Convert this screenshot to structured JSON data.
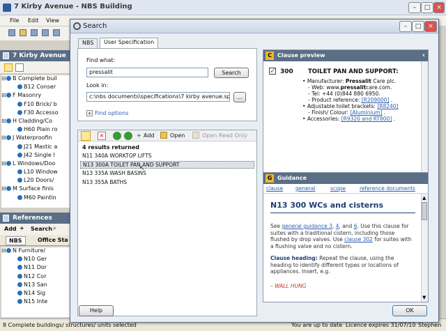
{
  "app": {
    "title": "7 Kirby Avenue - NBS Building",
    "menus": [
      "File",
      "Edit",
      "View"
    ]
  },
  "left_panel": {
    "header": "7 Kirby Avenue",
    "tree": [
      {
        "label": "B Complete buil",
        "level": 0,
        "expanded": true
      },
      {
        "label": "B12 Conser",
        "level": 1
      },
      {
        "label": "F Masonry",
        "level": 0,
        "expanded": true
      },
      {
        "label": "F10 Brick/ b",
        "level": 1
      },
      {
        "label": "F30 Accesso",
        "level": 1
      },
      {
        "label": "H Cladding/Co",
        "level": 0,
        "expanded": true
      },
      {
        "label": "H60 Plain ro",
        "level": 1
      },
      {
        "label": "J Waterproofin",
        "level": 0,
        "expanded": true
      },
      {
        "label": "J21 Mastic a",
        "level": 1
      },
      {
        "label": "J42 Single l",
        "level": 1
      },
      {
        "label": "L Windows/Doo",
        "level": 0,
        "expanded": true
      },
      {
        "label": "L10 Window",
        "level": 1
      },
      {
        "label": "L20 Doors/",
        "level": 1
      },
      {
        "label": "M Surface finis",
        "level": 0,
        "expanded": true
      },
      {
        "label": "M60 Paintin",
        "level": 1
      }
    ]
  },
  "references_panel": {
    "header": "References",
    "add_label": "Add",
    "search_label": "Search",
    "tabs": [
      "NBS",
      "Office Sta"
    ],
    "tree": [
      {
        "label": "N Furniture/",
        "level": 0
      },
      {
        "label": "N10 Ger",
        "level": 1
      },
      {
        "label": "N11 Dor",
        "level": 1
      },
      {
        "label": "N12 Cor",
        "level": 1
      },
      {
        "label": "N13 San",
        "level": 1
      },
      {
        "label": "N14 Sig",
        "level": 1
      },
      {
        "label": "N15 Inte",
        "level": 1
      }
    ]
  },
  "statusbar": {
    "left": "8 Complete buildings/ structures/ units selected",
    "mid": "You are up to date",
    "licence": "Licence expires 31/07/10",
    "user": "Stephen"
  },
  "dialog": {
    "title": "Search",
    "tabs": [
      "NBS",
      "User Specification"
    ],
    "find_what_label": "Find what:",
    "find_what_value": "pressalit",
    "search_button": "Search",
    "look_in_label": "Look in:",
    "look_in_value": "c:\\nbs documents\\specifications\\7 kirby avenue.spec",
    "browse_button": "...",
    "find_options": "Find options",
    "results_toolbar": {
      "add": "Add",
      "open": "Open",
      "open_read_only": "Open Read Only"
    },
    "results_count": "4 results returned",
    "results": [
      "N11 340A WORKTOP LIFTS",
      "N13 300A TOILET PAN AND SUPPORT",
      "N13 335A WASH BASINS",
      "N13 355A BATHS"
    ],
    "help_button": "Help",
    "ok_button": "OK"
  },
  "clause_preview": {
    "header_letter": "C",
    "header": "Clause preview",
    "number": "300",
    "title": "TOILET PAN AND SUPPORT:",
    "manufacturer_label": "Manufacturer:",
    "manufacturer": "Pressalit",
    "manufacturer_rest": "Care plc.",
    "web_label": "- Web: www.",
    "web_bold": "pressalit",
    "web_rest": "care.com.",
    "tel": "- Tel: +44 (0)844 880 6950.",
    "product_ref_label": "- Product reference:",
    "product_ref": "[R209000]",
    "brackets_label": "Adjustable toilet brackets:",
    "brackets_ref": "[R8240]",
    "finish_label": "- Finish/ Colour:",
    "finish_ref": "[Aluminium]",
    "accessories_label": "Accessories:",
    "accessories_ref1": "[R9320 and RT800]"
  },
  "guidance": {
    "header_letter": "G",
    "header": "Guidance",
    "links": [
      "clause",
      "general",
      "scope",
      "reference documents"
    ],
    "heading": "N13 300 WCs and cisterns",
    "p1_pre": "See ",
    "p1_link1": "general guidance 3",
    "p1_sep1": ", ",
    "p1_link2": "4",
    "p1_sep2": ", and ",
    "p1_link3": "6",
    "p1_mid": ". Use this clause for suites with a traditional cistern, including those flushed by drop valves. Use ",
    "p1_link4": "clause 302",
    "p1_post": " for suites with a flushing valve and no cistern.",
    "p2_bold": "Clause heading:",
    "p2_text": " Repeat the clause, using the heading to identify different types or locations of appliances. Insert, e.g.",
    "p3": "– WALL HUNG"
  },
  "colors": {
    "accent": "#5a6e86",
    "link": "#2a5db0",
    "red_text": "#c0392b",
    "check": "#2e8b2e"
  }
}
